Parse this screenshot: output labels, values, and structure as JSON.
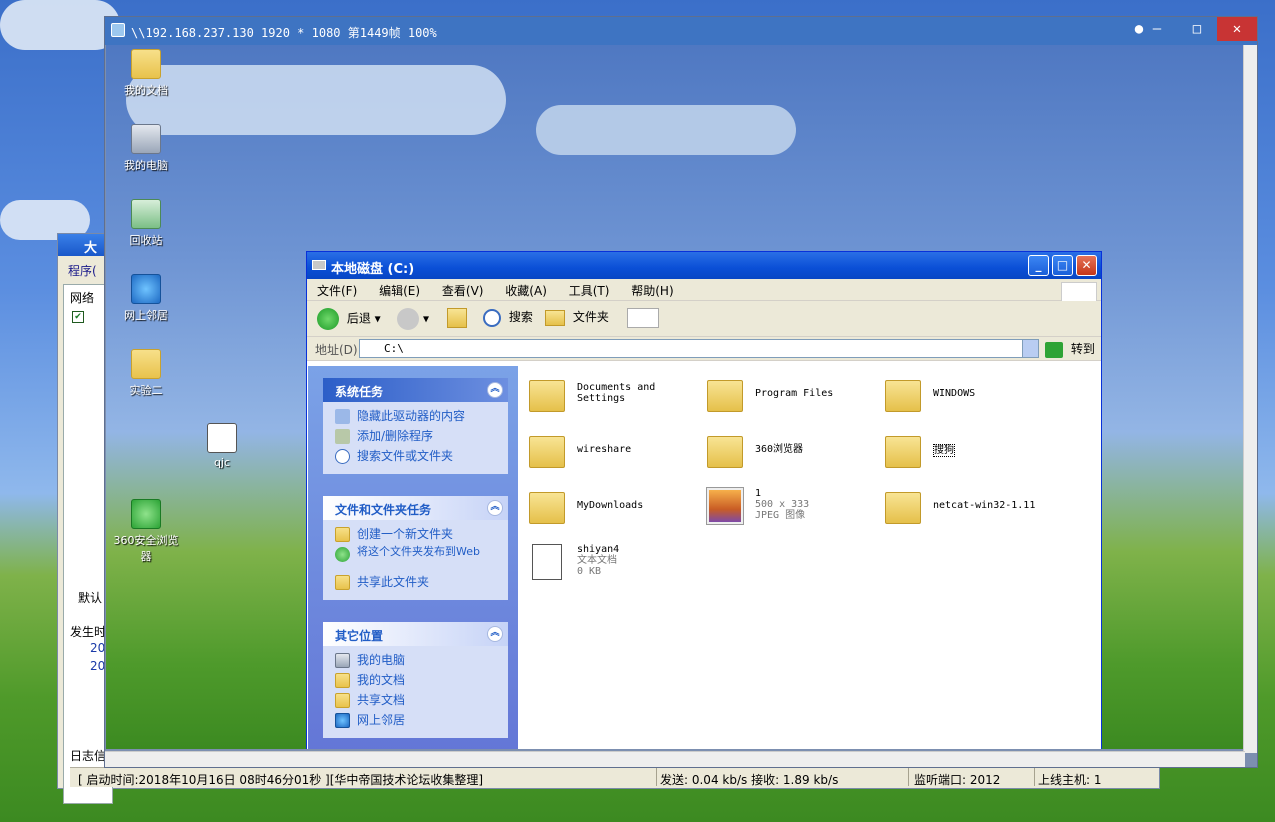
{
  "bg_window": {
    "title": "大",
    "menu_label": "程序(",
    "panel_header": "网络",
    "panel_tab": "默认",
    "log_header": "发生时",
    "log_rows": [
      "20",
      "20"
    ],
    "bottom_tab": "日志信",
    "status": {
      "start_time": "[ 启动时间:2018年10月16日 08时46分01秒 ][华中帝国技术论坛收集整理]",
      "speed": "发送: 0.04 kb/s 接收: 1.89 kb/s",
      "port": "监听端口: 2012",
      "hosts": "上线主机: 1"
    }
  },
  "viewer": {
    "title": "\\\\192.168.237.130 1920 * 1080 第1449帧 100%",
    "minimize": "—",
    "maximize": "□",
    "close": "✕"
  },
  "desktop_icons": [
    {
      "label": "我的文档",
      "icon": "folder-icon"
    },
    {
      "label": "我的电脑",
      "icon": "computer-icon"
    },
    {
      "label": "回收站",
      "icon": "recycle-bin-icon"
    },
    {
      "label": "网上邻居",
      "icon": "network-icon"
    },
    {
      "label": "实验二",
      "icon": "folder-icon"
    },
    {
      "label": "qjc",
      "icon": "application-icon"
    },
    {
      "label": "360安全浏览器",
      "icon": "browser-icon"
    }
  ],
  "explorer": {
    "title": "本地磁盘 (C:)",
    "menu": [
      "文件(F)",
      "编辑(E)",
      "查看(V)",
      "收藏(A)",
      "工具(T)",
      "帮助(H)"
    ],
    "toolbar": {
      "back": "后退",
      "search": "搜索",
      "folders": "文件夹"
    },
    "address": {
      "label": "地址(D)",
      "value": "C:\\",
      "go": "转到"
    },
    "system_tasks": {
      "title": "系统任务",
      "items": [
        "隐藏此驱动器的内容",
        "添加/删除程序",
        "搜索文件或文件夹"
      ]
    },
    "file_tasks": {
      "title": "文件和文件夹任务",
      "items": [
        "创建一个新文件夹",
        "将这个文件夹发布到Web",
        "共享此文件夹"
      ]
    },
    "other_places": {
      "title": "其它位置",
      "items": [
        "我的电脑",
        "我的文档",
        "共享文档",
        "网上邻居"
      ]
    },
    "files": [
      {
        "name": "Documents and Settings",
        "type": "folder"
      },
      {
        "name": "Program Files",
        "type": "folder"
      },
      {
        "name": "WINDOWS",
        "type": "folder"
      },
      {
        "name": "wireshare",
        "type": "folder"
      },
      {
        "name": "360浏览器",
        "type": "folder"
      },
      {
        "name": "搜狗",
        "type": "folder"
      },
      {
        "name": "MyDownloads",
        "type": "folder"
      },
      {
        "name": "1",
        "type": "jpg",
        "sub1": "500 x 333",
        "sub2": "JPEG 图像"
      },
      {
        "name": "netcat-win32-1.11",
        "type": "folder"
      },
      {
        "name": "shiyan4",
        "type": "txt",
        "sub1": "文本文档",
        "sub2": "0 KB"
      }
    ]
  }
}
